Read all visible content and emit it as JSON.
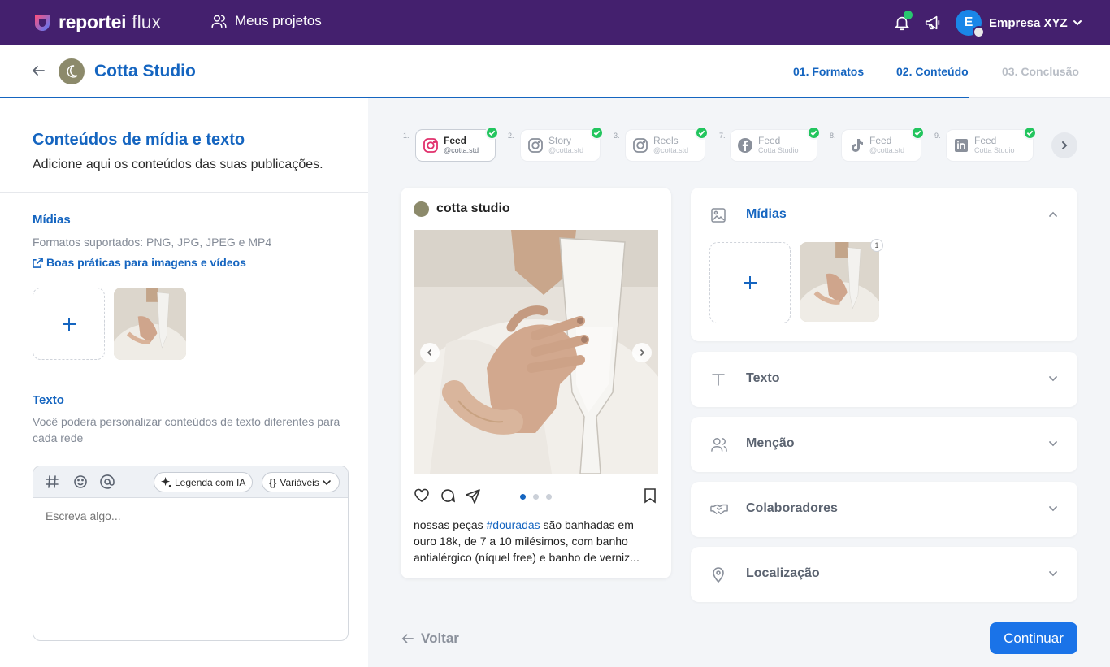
{
  "topbar": {
    "brand": "reportei",
    "product": "flux",
    "projects_label": "Meus projetos",
    "company_initial": "E",
    "company_name": "Empresa XYZ",
    "notification_dot_color": "#28c76f",
    "bg_color": "#44206e",
    "icons": [
      "logo-icon",
      "users-icon",
      "bell-icon",
      "megaphone-icon",
      "chevron-down-icon"
    ]
  },
  "header": {
    "client_name": "Cotta Studio",
    "steps": [
      {
        "label": "01. Formatos",
        "state": "done"
      },
      {
        "label": "02. Conteúdo",
        "state": "active"
      },
      {
        "label": "03. Conclusão",
        "state": "pending"
      }
    ],
    "step_progress_percent": 87
  },
  "left": {
    "title": "Conteúdos de mídia e texto",
    "subtitle": "Adicione aqui os conteúdos das suas publicações.",
    "media": {
      "title": "Mídias",
      "help": "Formatos suportados: PNG, JPG, JPEG e MP4",
      "link": "Boas práticas para imagens e vídeos"
    },
    "text": {
      "title": "Texto",
      "help": "Você poderá personalizar conteúdos de texto diferentes para cada rede",
      "ai_button": "Legenda com IA",
      "vars_button": "Variáveis",
      "placeholder": "Escreva algo..."
    }
  },
  "networks": [
    {
      "num": "1.",
      "label": "Feed",
      "handle": "@cotta.std",
      "network": "instagram",
      "active": true,
      "checked": true
    },
    {
      "num": "2.",
      "label": "Story",
      "handle": "@cotta.std",
      "network": "instagram",
      "active": false,
      "checked": true
    },
    {
      "num": "3.",
      "label": "Reels",
      "handle": "@cotta.std",
      "network": "instagram",
      "active": false,
      "checked": true
    },
    {
      "num": "7.",
      "label": "Feed",
      "handle": "Cotta Studio",
      "network": "facebook",
      "active": false,
      "checked": true
    },
    {
      "num": "8.",
      "label": "Feed",
      "handle": "@cotta.std",
      "network": "tiktok",
      "active": false,
      "checked": true
    },
    {
      "num": "9.",
      "label": "Feed",
      "handle": "Cotta Studio",
      "network": "linkedin",
      "active": false,
      "checked": true
    }
  ],
  "preview": {
    "account": "cotta studio",
    "caption_pre": "nossas peças ",
    "hashtag": "#douradas",
    "caption_post": " são banhadas em ouro 18k, de 7 a 10 milésimos, com banho antialérgico (níquel free) e banho de verniz...",
    "carousel_total": 3,
    "carousel_index": 1
  },
  "accordion": {
    "media": {
      "title": "Mídias",
      "badge": "1",
      "expanded": true
    },
    "text": {
      "title": "Texto",
      "expanded": false
    },
    "mention": {
      "title": "Menção",
      "expanded": false
    },
    "collab": {
      "title": "Colaboradores",
      "expanded": false
    },
    "location": {
      "title": "Localização",
      "expanded": false
    }
  },
  "footer": {
    "back_label": "Voltar",
    "continue_label": "Continuar"
  },
  "colors": {
    "accent": "#1565c0",
    "primary_button": "#1a73e8",
    "check": "#22c55e"
  }
}
